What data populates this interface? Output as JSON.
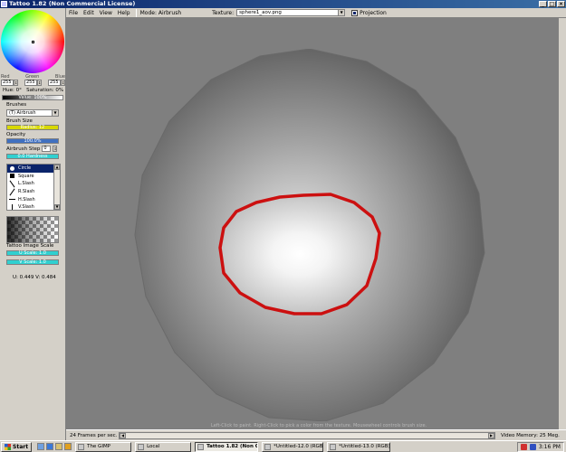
{
  "window": {
    "title": "Tattoo 1.82 (Non Commercial License)",
    "buttons": [
      "_",
      "□",
      "×"
    ]
  },
  "menu": [
    "File",
    "Edit",
    "View",
    "Help"
  ],
  "toolbar": {
    "mode": "Mode: Airbrush",
    "texture_label": "Texture:",
    "texture_value": "sphere1_aov.png",
    "projection_label": "Projection",
    "projection_checked": true
  },
  "color": {
    "labels": [
      "Red",
      "Green",
      "Blue"
    ],
    "red": "255",
    "green": "255",
    "blue": "255",
    "hue": "Hue: 0°",
    "saturation": "Saturation: 0%",
    "value": "Value: 100%"
  },
  "brushes": {
    "label": "Brushes",
    "selected": "(T) Airbrush",
    "size_label": "Brush Size",
    "size_value": "Radius: 12",
    "opacity_label": "Opacity",
    "opacity_value": "100.0%",
    "airbrush_step_label": "Airbrush Step",
    "airbrush_step_value": "0",
    "hardness_value": "0.0 Hardness",
    "shapes": [
      {
        "name": "Circle",
        "glyph": "g-circle",
        "selected": true
      },
      {
        "name": "Square",
        "glyph": "g-square",
        "selected": false
      },
      {
        "name": "L.Slash",
        "glyph": "g-lslash",
        "selected": false
      },
      {
        "name": "R.Slash",
        "glyph": "g-rslash",
        "selected": false
      },
      {
        "name": "H.Slash",
        "glyph": "g-hslash",
        "selected": false
      },
      {
        "name": "V.Slash",
        "glyph": "g-vslash",
        "selected": false
      }
    ]
  },
  "image_scale": {
    "label": "Tattoo Image Scale",
    "u_value": "U Scale: 1.0",
    "v_value": "V Scale: 1.0",
    "uv_readout": "U: 0.449  V: 0.484"
  },
  "viewport": {
    "hint": "Left-Click to paint. Right-Click to pick a color from the texture. Mousewheel controls brush size."
  },
  "status": {
    "fps": "24 Frames per sec.",
    "video_memory": "Video Memory: 25 Meg."
  },
  "taskbar": {
    "start": "Start",
    "tasks": [
      {
        "label": "The GIMP",
        "active": false
      },
      {
        "label": "Local",
        "active": false
      },
      {
        "label": "Tattoo 1.82 (Non C...",
        "active": true
      },
      {
        "label": "*Untitled-12.0 (RGB)...",
        "active": false
      },
      {
        "label": "*Untitled-13.0 (RGB)...",
        "active": false
      }
    ],
    "clock": "3:16 PM"
  },
  "colors": {
    "titlebar": "#0a246a",
    "panel": "#d4d0c8",
    "viewport_bg": "#7f7f7f",
    "brush_outline": "#cc1010"
  }
}
